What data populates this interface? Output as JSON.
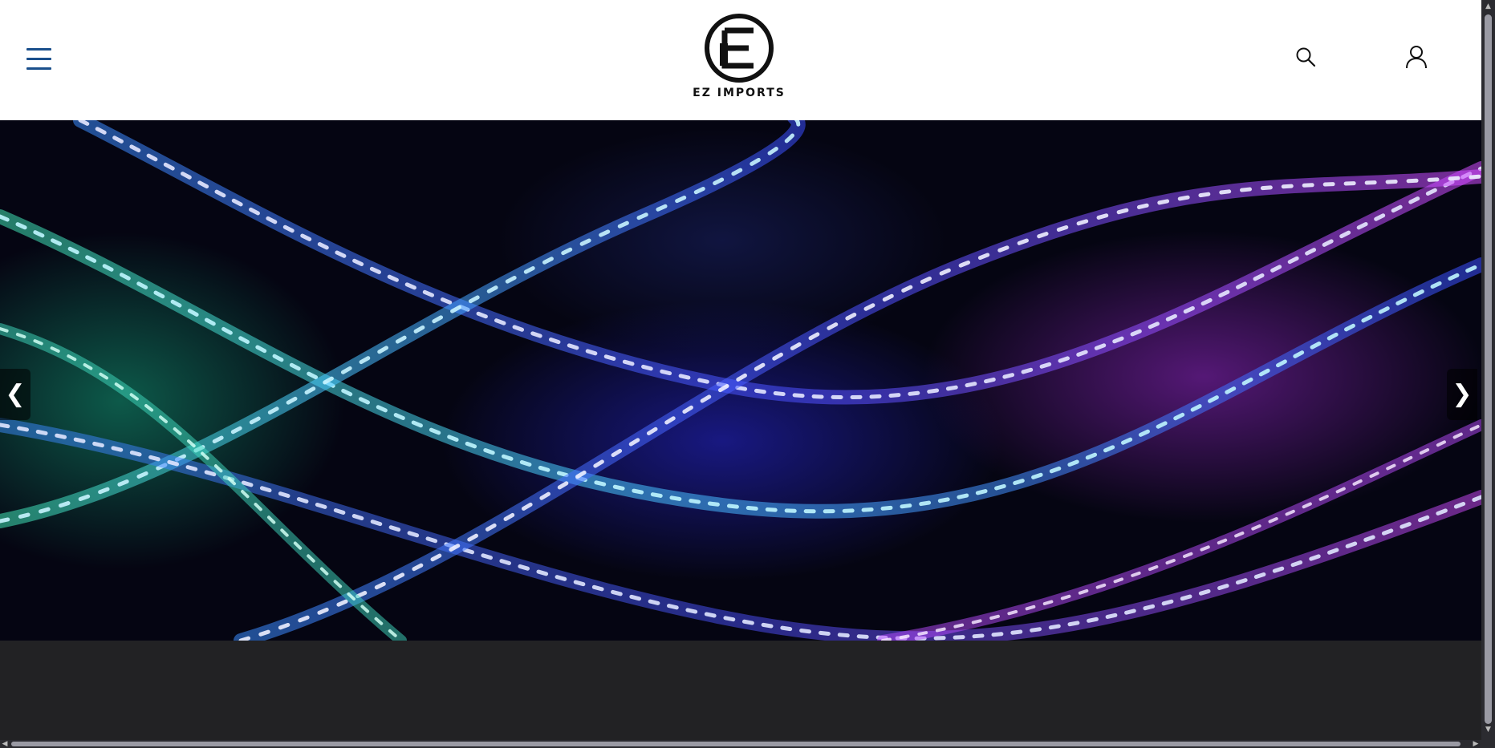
{
  "header": {
    "logo_text": "EZ IMPORTS",
    "logo_mark": "E",
    "menu_icon": "hamburger-menu-icon",
    "search_icon": "search-icon",
    "account_icon": "user-account-icon"
  },
  "hero": {
    "image": "led-strip-lights-banner",
    "prev_label": "❮",
    "next_label": "❯"
  },
  "colors": {
    "header_bg": "#ffffff",
    "menu_icon": "#1a4f8c",
    "footer_band": "#222224",
    "hero_bg": "#050512",
    "led_cyan": "#5fe8ff",
    "led_blue": "#3a4cff",
    "led_purple": "#c24bff"
  }
}
